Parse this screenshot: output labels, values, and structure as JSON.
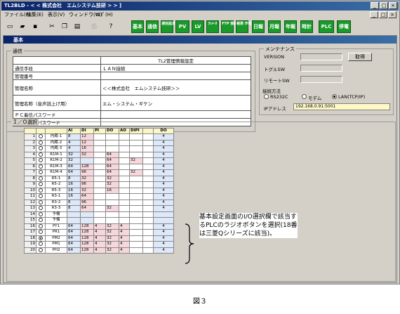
{
  "window": {
    "title": "TL2BLD - < < 株式会社　エムシステム技研 > > ]"
  },
  "menu": [
    "ファイル(F)",
    "編集(E)",
    "表示(V)",
    "ウィンドウ(W)",
    "ﾍﾙﾌﾟ(H)"
  ],
  "toolbar_buttons": [
    "基本",
    "通信",
    "通信設定",
    "PV",
    "LV",
    "ﾃﾚﾒｰﾀ",
    "FTP 接続",
    "帳票 作成",
    "日報",
    "月報",
    "年報",
    "時計",
    "PLC",
    "停電"
  ],
  "inner_window": {
    "title": "基本"
  },
  "comm": {
    "legend": "通信",
    "table_title": "TL2管理情報設定",
    "rows": [
      {
        "label": "通信手段",
        "value": "ＬＡＮ接続"
      },
      {
        "label": "管理番号",
        "value": ""
      },
      {
        "label": "管理名称",
        "value": "＜＜株式会社　エムシステム技研＞＞"
      },
      {
        "label": "管理名称（音声読上げ用）",
        "value": "エム・システム・ギケン"
      },
      {
        "label": "ＰＣ着信パスワード",
        "value": ""
      },
      {
        "label": "ＴＥＬ着信パスワード",
        "value": ""
      }
    ]
  },
  "maint": {
    "legend": "メンテナンス",
    "version_label": "VERSION",
    "toggle_label": "トグルSW",
    "remote_label": "リモートSW",
    "get_button": "取得",
    "connection_label": "接続方法",
    "options": [
      "RS232C",
      "モデム",
      "LAN(TCP/IP)"
    ],
    "selected_option": "LAN(TCP/IP)",
    "ip_label": "IPアドレス",
    "ip_value": "192.168.0.91:5001"
  },
  "io": {
    "legend": "Ｉ／Ｏ選択",
    "headers": [
      "AI",
      "DI",
      "PI",
      "DO",
      "AO",
      "DIPI",
      "",
      "DO"
    ],
    "rows": [
      {
        "no": "1",
        "sel": false,
        "name": "内蔵-1",
        "ai": "8",
        "di": "12",
        "pi": "",
        "do": "",
        "ao": "",
        "dipi": "",
        "do2": "4"
      },
      {
        "no": "2",
        "sel": false,
        "name": "内蔵-2",
        "ai": "4",
        "di": "12",
        "pi": "",
        "do": "",
        "ao": "",
        "dipi": "",
        "do2": "4"
      },
      {
        "no": "3",
        "sel": false,
        "name": "内蔵-3",
        "ai": "4",
        "di": "16",
        "pi": "",
        "do": "",
        "ao": "",
        "dipi": "",
        "do2": "4"
      },
      {
        "no": "4",
        "sel": false,
        "name": "R1M-1",
        "ai": "32",
        "di": "32",
        "pi": "",
        "do": "64",
        "ao": "",
        "dipi": "",
        "do2": "4"
      },
      {
        "no": "5",
        "sel": false,
        "name": "R1M-2",
        "ai": "32",
        "di": "",
        "pi": "",
        "do": "64",
        "ao": "",
        "dipi": "32",
        "do2": "4"
      },
      {
        "no": "6",
        "sel": false,
        "name": "R1M-3",
        "ai": "64",
        "di": "128",
        "pi": "",
        "do": "64",
        "ao": "",
        "dipi": "",
        "do2": "4"
      },
      {
        "no": "7",
        "sel": false,
        "name": "R1M-4",
        "ai": "64",
        "di": "96",
        "pi": "",
        "do": "64",
        "ao": "",
        "dipi": "32",
        "do2": "4"
      },
      {
        "no": "8",
        "sel": false,
        "name": "R5-1",
        "ai": "8",
        "di": "32",
        "pi": "",
        "do": "32",
        "ao": "",
        "dipi": "",
        "do2": "4"
      },
      {
        "no": "9",
        "sel": false,
        "name": "R5-2",
        "ai": "16",
        "di": "96",
        "pi": "",
        "do": "32",
        "ao": "",
        "dipi": "",
        "do2": "4"
      },
      {
        "no": "10",
        "sel": false,
        "name": "R5-3",
        "ai": "16",
        "di": "32",
        "pi": "",
        "do": "16",
        "ao": "",
        "dipi": "",
        "do2": "4"
      },
      {
        "no": "11",
        "sel": false,
        "name": "R3-1",
        "ai": "16",
        "di": "64",
        "pi": "",
        "do": "",
        "ao": "",
        "dipi": "",
        "do2": "4"
      },
      {
        "no": "12",
        "sel": false,
        "name": "R3-2",
        "ai": "8",
        "di": "96",
        "pi": "",
        "do": "",
        "ao": "",
        "dipi": "",
        "do2": "4"
      },
      {
        "no": "13",
        "sel": false,
        "name": "R3-3",
        "ai": "8",
        "di": "64",
        "pi": "",
        "do": "32",
        "ao": "",
        "dipi": "",
        "do2": "4"
      },
      {
        "no": "14",
        "sel": false,
        "name": "予備",
        "ai": "",
        "di": "",
        "pi": "",
        "do": "",
        "ao": "",
        "dipi": "",
        "do2": ""
      },
      {
        "no": "15",
        "sel": false,
        "name": "予備",
        "ai": "",
        "di": "",
        "pi": "",
        "do": "",
        "ao": "",
        "dipi": "",
        "do2": ""
      },
      {
        "no": "16",
        "sel": false,
        "name": "PY1",
        "ai": "64",
        "di": "128",
        "pi": "4",
        "do": "32",
        "ao": "4",
        "dipi": "",
        "do2": "4"
      },
      {
        "no": "17",
        "sel": false,
        "name": "PR1",
        "ai": "64",
        "di": "128",
        "pi": "4",
        "do": "32",
        "ao": "4",
        "dipi": "",
        "do2": "4"
      },
      {
        "no": "18",
        "sel": true,
        "name": "PM2",
        "ai": "64",
        "di": "128",
        "pi": "4",
        "do": "32",
        "ao": "4",
        "dipi": "",
        "do2": "4"
      },
      {
        "no": "19",
        "sel": false,
        "name": "PM1",
        "ai": "64",
        "di": "128",
        "pi": "4",
        "do": "32",
        "ao": "4",
        "dipi": "",
        "do2": "4"
      },
      {
        "no": "20",
        "sel": false,
        "name": "PH2",
        "ai": "64",
        "di": "128",
        "pi": "4",
        "do": "32",
        "ao": "4",
        "dipi": "",
        "do2": "4"
      }
    ]
  },
  "annotation": "基本設定画面のI/O選択欄で該当するPLCのラジオボタンを選択(18番は三菱Qシリーズに該当)。",
  "caption": "図３"
}
